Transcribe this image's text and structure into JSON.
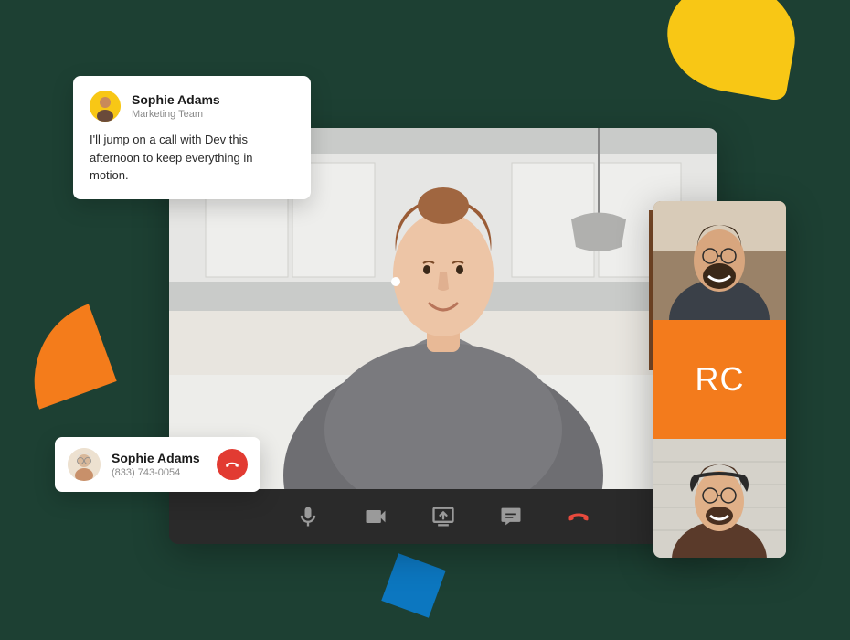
{
  "message": {
    "author_name": "Sophie Adams",
    "author_subtitle": "Marketing Team",
    "body": "I'll jump on a call with Dev this afternoon to keep everything in motion."
  },
  "contact": {
    "name": "Sophie Adams",
    "phone": "(833) 743-0054"
  },
  "participants": {
    "initials_tile": "RC"
  },
  "toolbar": {
    "mic": "microphone-icon",
    "video": "video-icon",
    "share": "screen-share-icon",
    "chat": "chat-icon",
    "end": "end-call-icon"
  }
}
